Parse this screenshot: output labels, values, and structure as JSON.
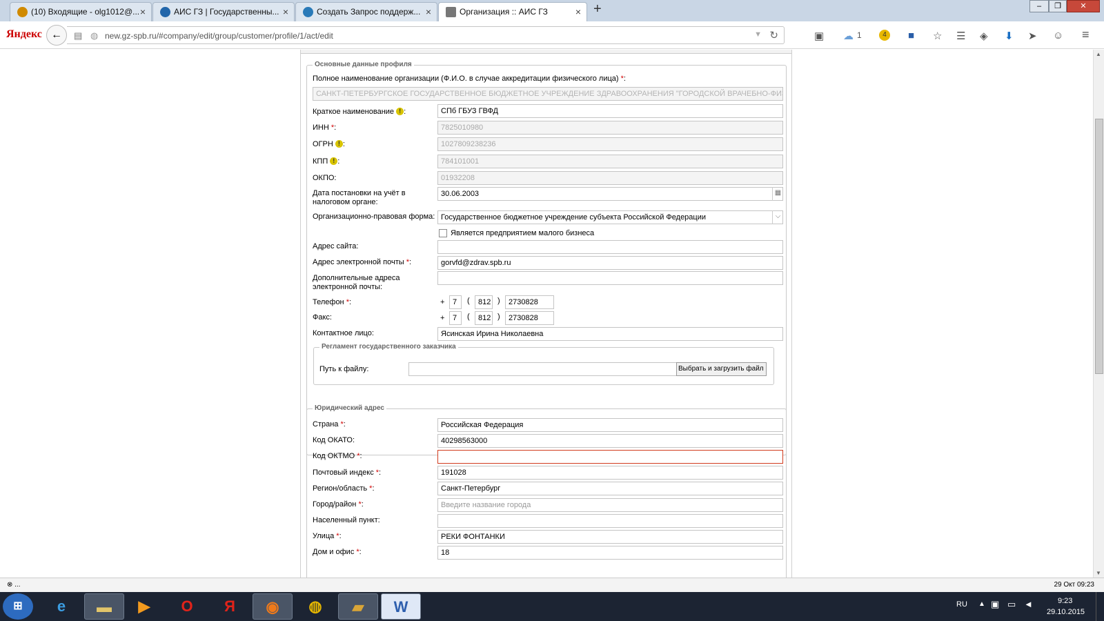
{
  "tabs": [
    {
      "label": "(10) Входящие - olg1012@...",
      "icon": "mail-icon",
      "color": "#d08a00"
    },
    {
      "label": "АИС ГЗ | Государственны...",
      "icon": "gz-icon",
      "color": "#2266aa"
    },
    {
      "label": "Создать Запрос поддерж...",
      "icon": "support-icon",
      "color": "#2a7ab8"
    },
    {
      "label": "Организация :: АИС ГЗ",
      "icon": "tools-icon",
      "color": "#555555"
    }
  ],
  "browser": {
    "brand": "Яндекс",
    "url": "new.gz-spb.ru/#company/edit/group/customer/profile/1/act/edit",
    "cloud_count": "1",
    "badge": "4"
  },
  "profile": {
    "legend": "Основные данные профиля",
    "full_name_label": "Полное наименование организации (Ф.И.О. в случае аккредитации физического лица)",
    "full_name": "САНКТ-ПЕТЕРБУРГСКОЕ ГОСУДАРСТВЕННОЕ БЮДЖЕТНОЕ УЧРЕЖДЕНИЕ ЗДРАВООХРАНЕНИЯ \"ГОРОДСКОЙ ВРАЧЕБНО-ФИЗКУЛЬТУР",
    "short_label": "Краткое наименование",
    "short": "СПб ГБУЗ ГВФД",
    "inn_label": "ИНН",
    "inn": "7825010980",
    "ogrn_label": "ОГРН",
    "ogrn": "1027809238236",
    "kpp_label": "КПП",
    "kpp": "784101001",
    "okpo_label": "ОКПО:",
    "okpo": "01932208",
    "tax_date_label": "Дата постановки на учёт в налоговом органе:",
    "tax_date": "30.06.2003",
    "opf_label": "Организационно-правовая форма:",
    "opf": "Государственное бюджетное учреждение субъекта Российской Федерации",
    "small_biz_label": "Является предприятием малого бизнеса",
    "site_label": "Адрес сайта:",
    "site": "",
    "email_label": "Адрес электронной почты",
    "email": "gorvfd@zdrav.spb.ru",
    "extra_email_label": "Дополнительные адреса электронной почты:",
    "extra_email": "",
    "phone_label": "Телефон",
    "phone": {
      "country": "7",
      "code": "812",
      "number": "2730828"
    },
    "fax_label": "Факс:",
    "fax": {
      "country": "7",
      "code": "812",
      "number": "2730828"
    },
    "contact_label": "Контактное лицо:",
    "contact": "Ясинская Ирина Николаевна",
    "reg_legend": "Регламент государственного заказчика",
    "file_label": "Путь к файлу:",
    "file_button": "Выбрать и загрузить файл"
  },
  "address": {
    "legend": "Юридический адрес",
    "country_label": "Страна",
    "country": "Российская Федерация",
    "okato_label": "Код ОКАТО:",
    "okato": "40298563000",
    "oktmo_label": "Код ОКТМО",
    "oktmo": "",
    "zip_label": "Почтовый индекс",
    "zip": "191028",
    "region_label": "Регион/область",
    "region": "Санкт-Петербург",
    "city_label": "Город/район",
    "city_placeholder": "Введите название города",
    "locality_label": "Населенный пункт:",
    "locality": "",
    "street_label": "Улица",
    "street": "РЕКИ ФОНТАНКИ",
    "house_label": "Дом и офис",
    "house": "18"
  },
  "status": {
    "left": "⊗ ...",
    "right": "29 Окт 09:23"
  },
  "taskbar": {
    "lang": "RU",
    "time": "9:23",
    "date": "29.10.2015"
  }
}
